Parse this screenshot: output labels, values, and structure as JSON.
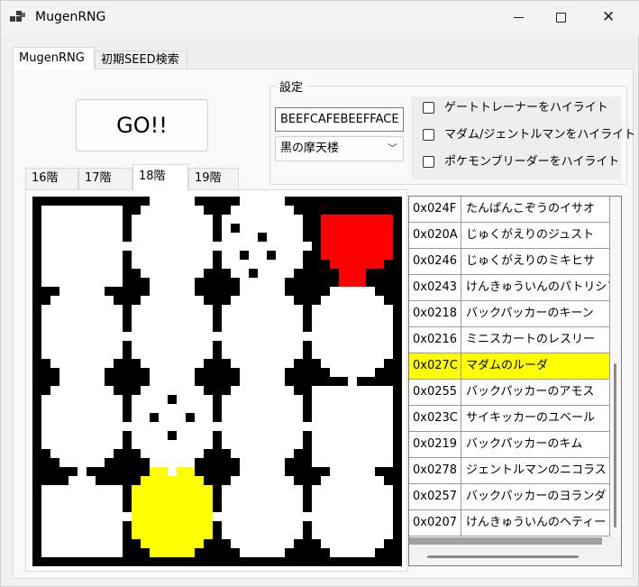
{
  "window": {
    "title": "MugenRNG",
    "icon": "app-window-icon",
    "controls": {
      "minimize": "—",
      "maximize": "□",
      "close": "✕"
    }
  },
  "tabs": [
    {
      "label": "MugenRNG",
      "selected": true
    },
    {
      "label": "初期SEED検索",
      "selected": false
    }
  ],
  "main": {
    "go_button": "GO!!",
    "settings": {
      "group_label": "設定",
      "seed_value": "BEEFCAFEBEEFFACE",
      "floor_selected": "黒の摩天楼",
      "checkboxes": [
        {
          "label": "ゲートトレーナーをハイライト",
          "checked": false
        },
        {
          "label": "マダム/ジェントルマンをハイライト",
          "checked": false
        },
        {
          "label": "ポケモンブリーダーをハイライト",
          "checked": false
        }
      ]
    },
    "floor_tabs": [
      {
        "label": "16階",
        "selected": false
      },
      {
        "label": "17階",
        "selected": false
      },
      {
        "label": "18階",
        "selected": true
      },
      {
        "label": "19階",
        "selected": false
      }
    ],
    "map": {
      "colors": {
        "wall": "#000000",
        "room": "#ffffff",
        "highlight_red": "#ff0000",
        "highlight_yellow": "#ffff00"
      }
    },
    "trainer_list": {
      "highlight_color": "#ffff00",
      "rows": [
        {
          "id": "0x024F",
          "name": "たんぱんこぞうのイサオ",
          "highlighted": false
        },
        {
          "id": "0x020A",
          "name": "じゅくがえりのジュスト",
          "highlighted": false
        },
        {
          "id": "0x0246",
          "name": "じゅくがえりのミキヒサ",
          "highlighted": false
        },
        {
          "id": "0x0243",
          "name": "けんきゅういんのパトリシア",
          "highlighted": false
        },
        {
          "id": "0x0218",
          "name": "バックパッカーのキーン",
          "highlighted": false
        },
        {
          "id": "0x0216",
          "name": "ミニスカートのレスリー",
          "highlighted": false
        },
        {
          "id": "0x027C",
          "name": "マダムのルーダ",
          "highlighted": true
        },
        {
          "id": "0x0255",
          "name": "バックパッカーのアモス",
          "highlighted": false
        },
        {
          "id": "0x023C",
          "name": "サイキッカーのユベール",
          "highlighted": false
        },
        {
          "id": "0x0219",
          "name": "バックパッカーのキム",
          "highlighted": false
        },
        {
          "id": "0x0278",
          "name": "ジェントルマンのニコラス",
          "highlighted": false
        },
        {
          "id": "0x0257",
          "name": "バックパッカーのヨランダ",
          "highlighted": false
        },
        {
          "id": "0x0207",
          "name": "けんきゅういんのヘティー",
          "highlighted": false
        }
      ]
    }
  }
}
